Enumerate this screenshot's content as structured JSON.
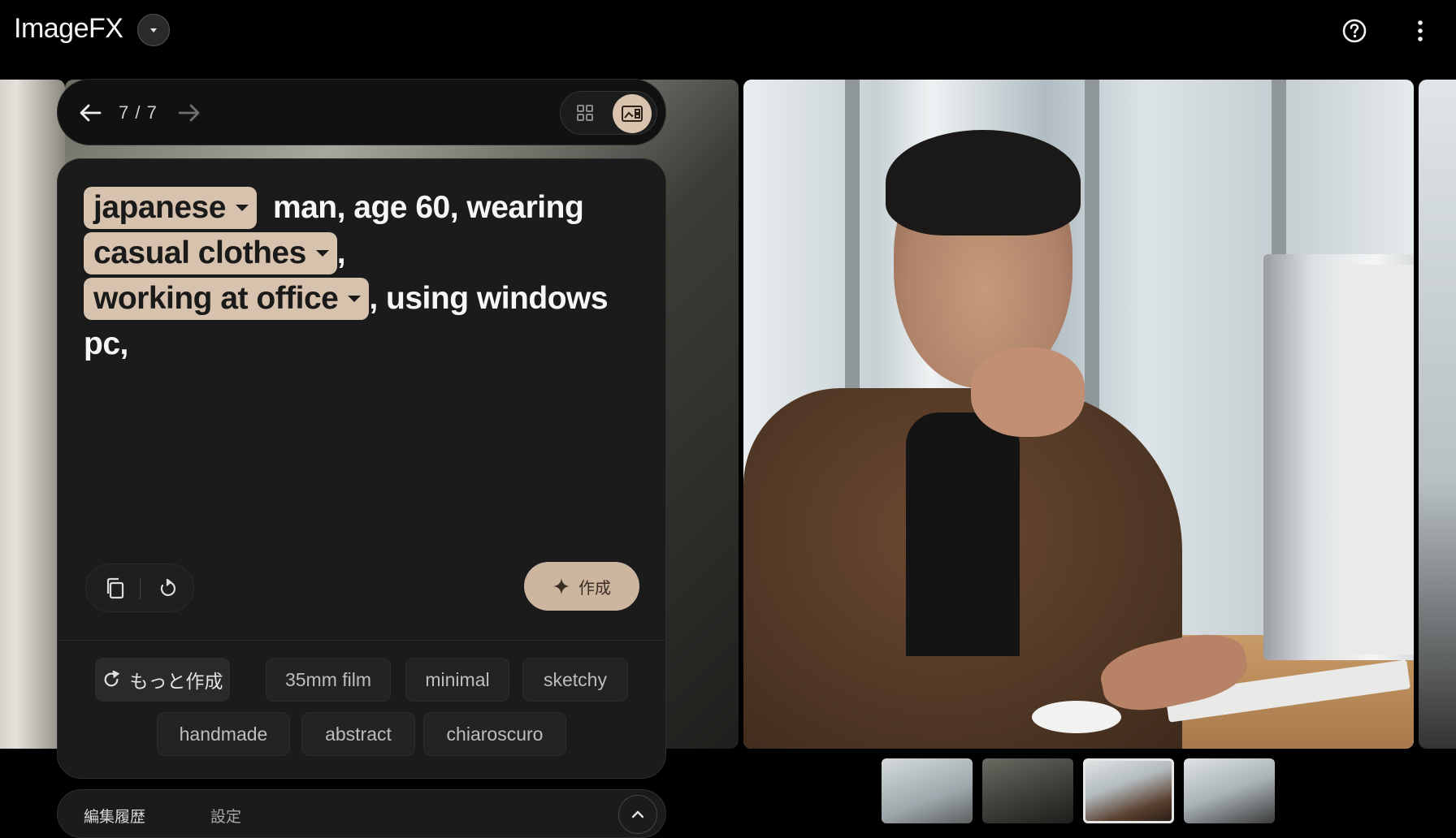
{
  "app": {
    "title": "ImageFX"
  },
  "header": {
    "model_icon": "chevron-down-icon",
    "help_icon": "help-circle-icon",
    "more_icon": "more-vert-icon"
  },
  "pager": {
    "counter": "7 / 7",
    "back_icon": "arrow-left-icon",
    "forward_icon": "arrow-right-icon",
    "view_grid_icon": "grid-icon",
    "view_single_icon": "single-view-icon"
  },
  "prompt": {
    "chip1": "japanese",
    "text1": "man, age 60, wearing",
    "chip2": "casual clothes",
    "text2": ",",
    "chip3": "working at office",
    "text3": ", using windows",
    "text4": "pc,"
  },
  "tools": {
    "copy_icon": "copy-icon",
    "reset_icon": "refresh-icon",
    "create_label": "作成",
    "create_icon": "sparkle-icon"
  },
  "suggestions": {
    "more_label": "もっと作成",
    "items": [
      "35mm film",
      "minimal",
      "sketchy",
      "handmade",
      "abstract",
      "chiaroscuro"
    ]
  },
  "bottom_tabs": {
    "history": "編集履歴",
    "settings": "設定"
  },
  "thumbnails": {
    "count": 4,
    "selected_index": 2
  }
}
